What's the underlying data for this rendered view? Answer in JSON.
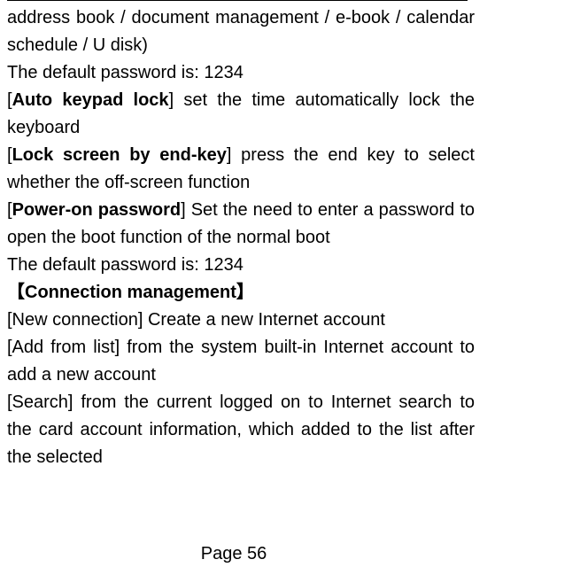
{
  "body": {
    "line1": "address book / document management / e-book / calendar schedule / U disk)",
    "line2": "The default password is: 1234",
    "autokeypad_label": "Auto keypad lock",
    "autokeypad_rest": "] set the time automatically lock the keyboard",
    "lockscreen_label": "Lock screen by end-key",
    "lockscreen_rest": "] press the end key to select whether the off-screen function",
    "poweron_label": "Power-on password",
    "poweron_rest": "] Set the need to enter a password to open the boot function of the normal boot",
    "line_default2": "The default password is: 1234",
    "conn_heading": "【Connection management】",
    "newconn": "[New connection] Create a new Internet account",
    "addfromlist": "[Add from list] from the system built-in Internet account to add a new account",
    "search": "[Search] from the current logged on to Internet search to the card account information, which added to the list after the selected"
  },
  "footer": {
    "page": "Page 56"
  }
}
